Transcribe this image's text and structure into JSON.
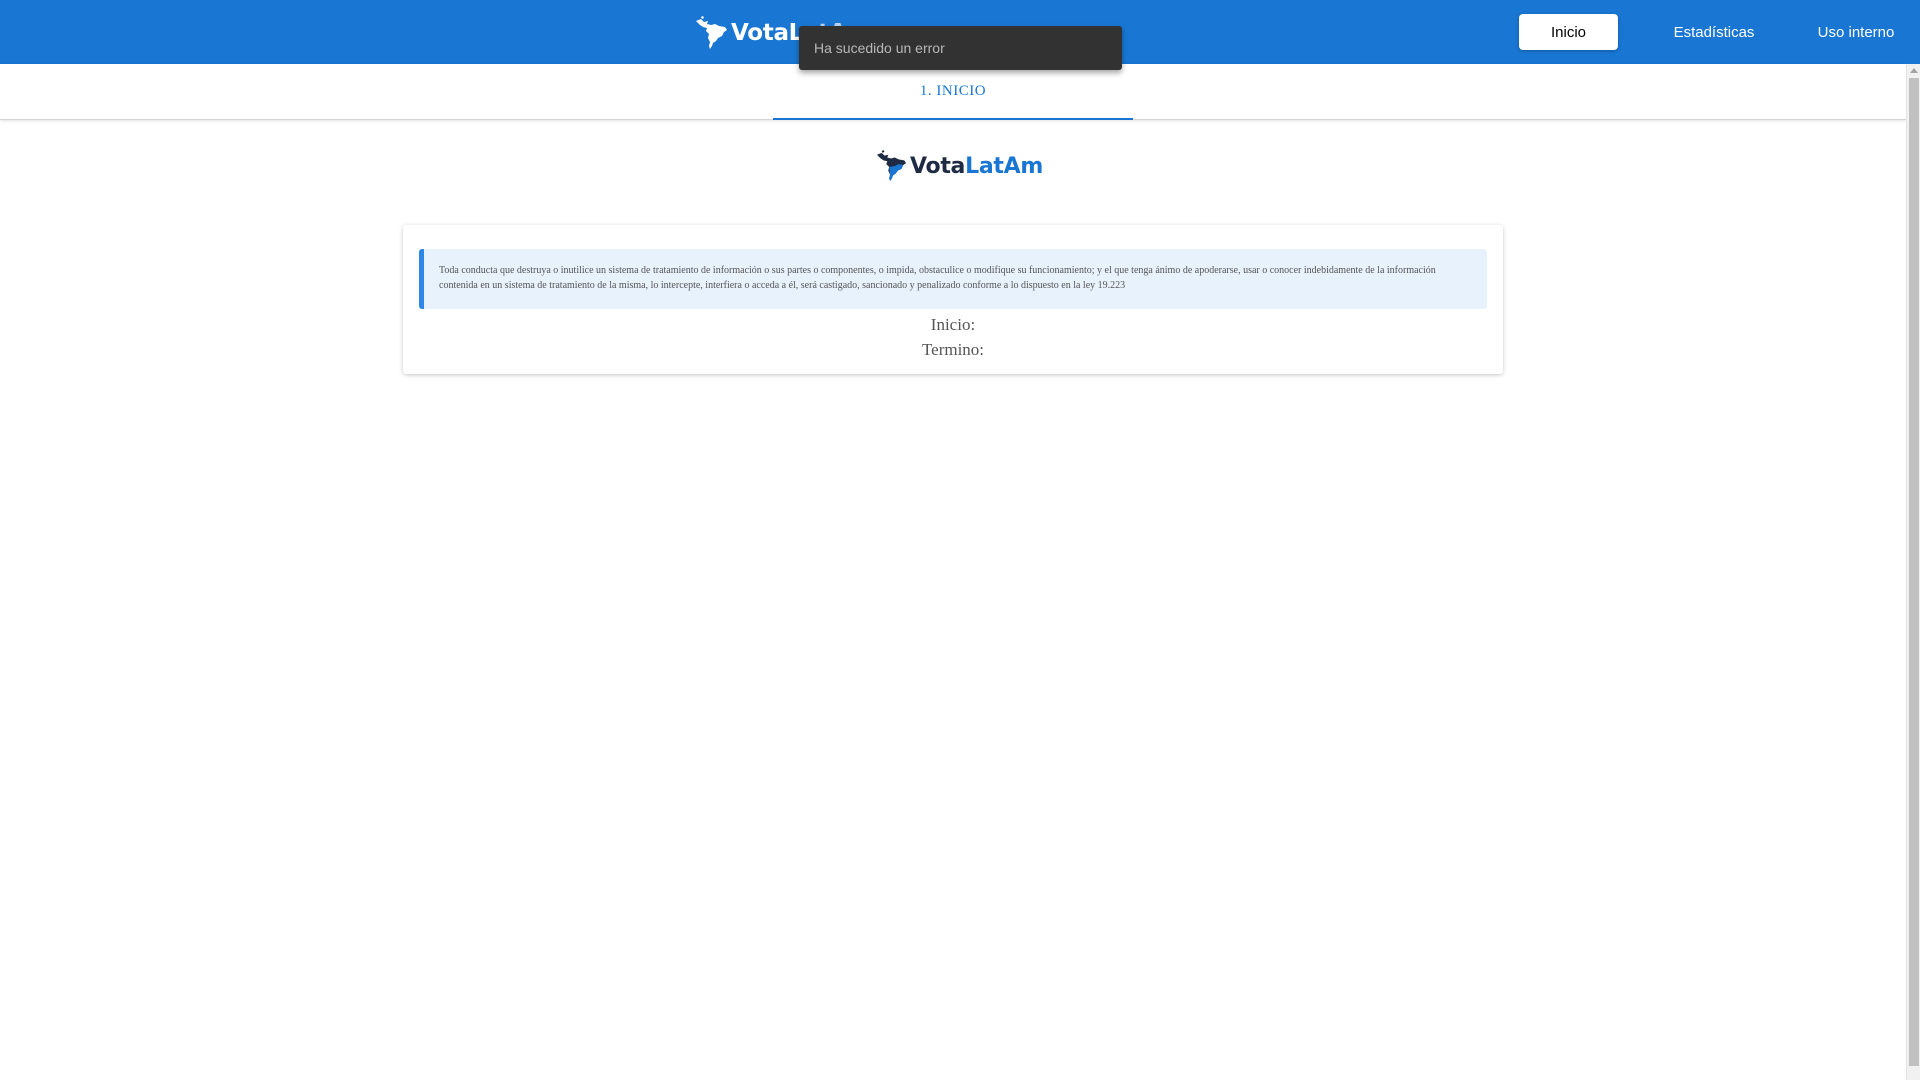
{
  "header": {
    "logo": {
      "text_main": "VotaL",
      "text_accent": "atAm"
    },
    "nav": [
      {
        "label": "Inicio",
        "active": true
      },
      {
        "label": "Estadísticas",
        "active": false
      },
      {
        "label": "Uso interno",
        "active": false
      }
    ]
  },
  "toast": {
    "message": "Ha sucedido un error"
  },
  "tabs": [
    {
      "label": "1. INICIO",
      "active": true
    }
  ],
  "main": {
    "logo": {
      "text_main": "Vota",
      "text_accent": "LatAm"
    },
    "notice": "Toda conducta que destruya o inutilice un sistema de tratamiento de información o sus partes o componentes, o impida, obstaculice o modifique su funcionamiento; y el que tenga ánimo de apoderarse, usar o conocer indebidamente de la información contenida en un sistema de tratamiento de la misma, lo intercepte, interfiera o acceda a él, será castigado, sancionado y penalizado conforme a lo dispuesto en la ley 19.223",
    "start_label": "Inicio:",
    "end_label": "Termino:"
  },
  "colors": {
    "primary": "#1976d2",
    "toast_bg": "#323232",
    "notice_bg": "#e8f2fc",
    "notice_border": "#2e86e6"
  },
  "icons": {
    "logo_mark": "latin-america-map-icon"
  }
}
